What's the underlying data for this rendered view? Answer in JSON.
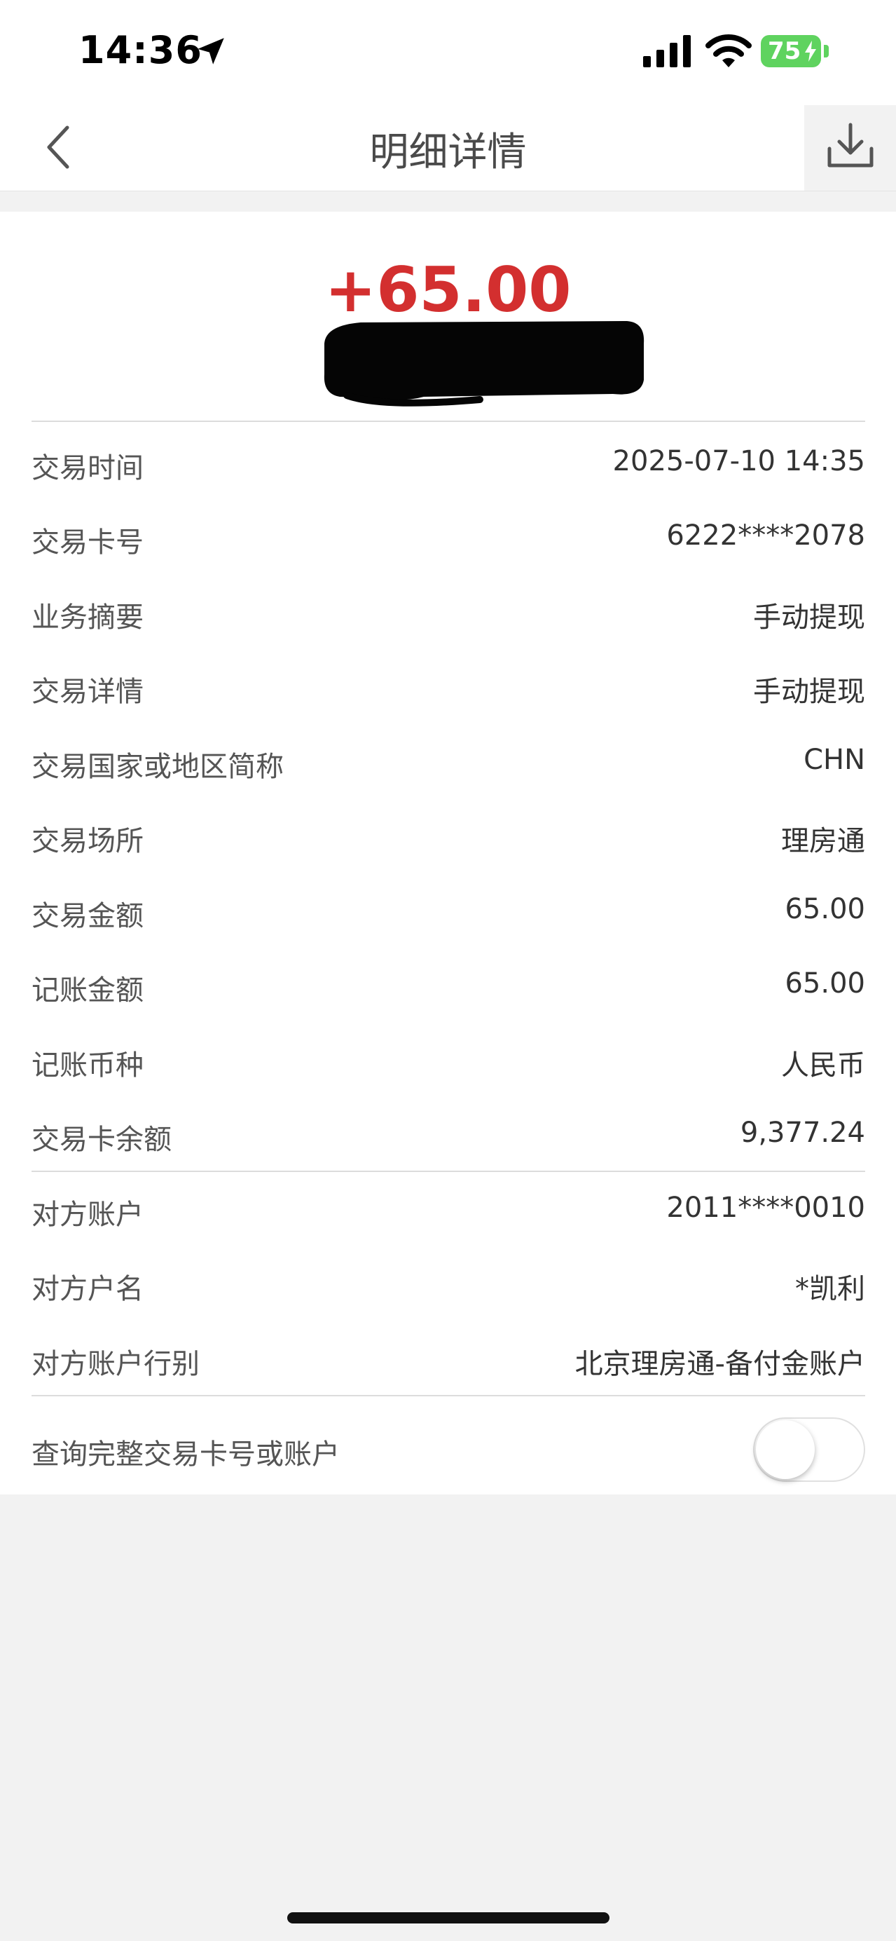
{
  "status_bar": {
    "time": "14:36",
    "battery": "75"
  },
  "nav": {
    "title": "明细详情"
  },
  "summary": {
    "amount": "+65.00"
  },
  "details": [
    {
      "label": "交易时间",
      "value": "2025-07-10 14:35"
    },
    {
      "label": "交易卡号",
      "value": "6222****2078"
    },
    {
      "label": "业务摘要",
      "value": "手动提现"
    },
    {
      "label": "交易详情",
      "value": "手动提现"
    },
    {
      "label": "交易国家或地区简称",
      "value": "CHN"
    },
    {
      "label": "交易场所",
      "value": "理房通"
    },
    {
      "label": "交易金额",
      "value": "65.00"
    },
    {
      "label": "记账金额",
      "value": "65.00"
    },
    {
      "label": "记账币种",
      "value": "人民币"
    },
    {
      "label": "交易卡余额",
      "value": "9,377.24"
    }
  ],
  "counterparty": [
    {
      "label": "对方账户",
      "value": "2011****0010"
    },
    {
      "label": "对方户名",
      "value": "*凯利"
    },
    {
      "label": "对方账户行别",
      "value": "北京理房通-备付金账户"
    }
  ],
  "toggle": {
    "label": "查询完整交易卡号或账户",
    "on": false
  },
  "colors": {
    "amount": "#d32f2f",
    "battery": "#5fd35f",
    "toggle_off": "#ffffff"
  }
}
